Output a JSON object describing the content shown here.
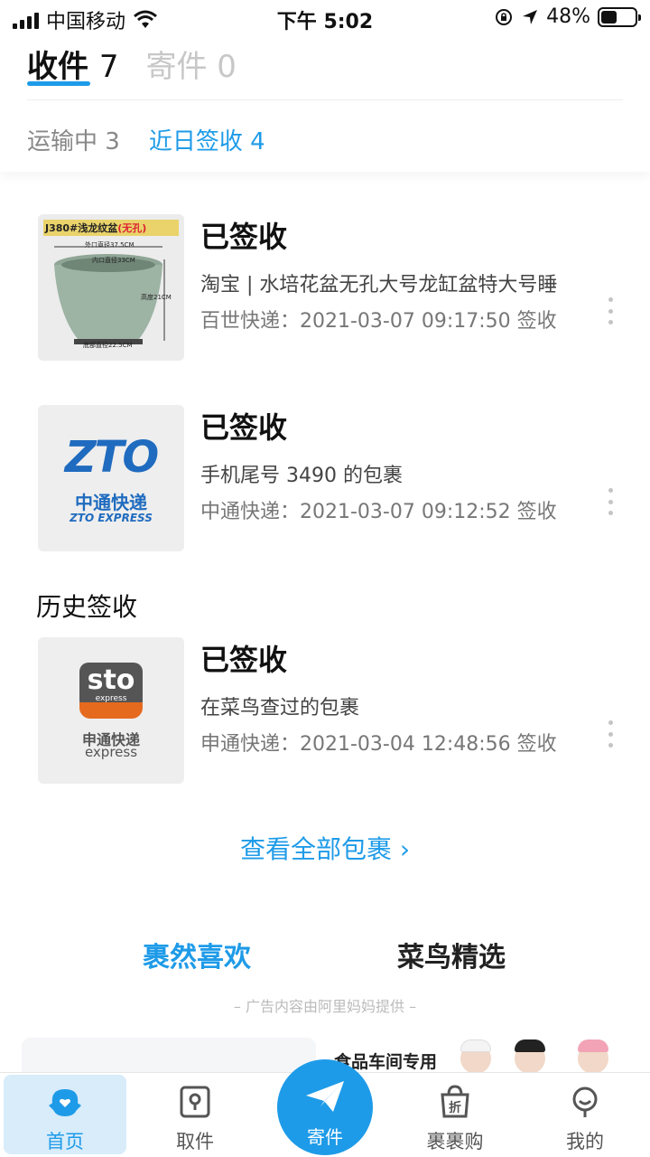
{
  "status_bar": {
    "carrier": "中国移动",
    "time": "下午 5:02",
    "battery": "48%",
    "battery_level": 0.48
  },
  "header": {
    "tabs": [
      {
        "label": "收件",
        "count": "7"
      },
      {
        "label": "寄件",
        "count": "0"
      }
    ],
    "sub_tabs": [
      {
        "label": "运输中",
        "count": "3"
      },
      {
        "label": "近日签收",
        "count": "4"
      }
    ]
  },
  "packages": [
    {
      "status": "已签收",
      "description": "淘宝 | 水培花盆无孔大号龙缸盆特大号睡",
      "meta": "百世快递：2021-03-07 09:17:50 签收",
      "thumb_text": {
        "title": "J380#浅龙纹盆",
        "title_tag": "(无孔)",
        "outer": "外口直径37.5CM",
        "inner": "内口直径33CM",
        "height": "高度21CM",
        "bottom": "底部直径22.5CM"
      }
    },
    {
      "status": "已签收",
      "description": "手机尾号 3490 的包裹",
      "meta": "中通快递：2021-03-07 09:12:52 签收",
      "logo": {
        "mark": "ZTO",
        "cn": "中通快递",
        "en": "ZTO EXPRESS"
      }
    }
  ],
  "history": {
    "title": "历史签收",
    "packages": [
      {
        "status": "已签收",
        "description": "在菜鸟查过的包裹",
        "meta": "申通快递：2021-03-04 12:48:56 签收",
        "logo": {
          "mark": "sto",
          "sub": "express",
          "cn": "申通快递",
          "en": "express"
        }
      }
    ]
  },
  "view_all": "查看全部包裹 ›",
  "recommend": {
    "tabs": [
      "裹然喜欢",
      "菜鸟精选"
    ],
    "ad_note": "– 广告内容由阿里妈妈提供 –",
    "banner_text": "食品车间专用"
  },
  "tab_bar": {
    "items": [
      "首页",
      "取件",
      "寄件",
      "裹裹购",
      "我的"
    ]
  },
  "colors": {
    "accent": "#1e9be8",
    "tab_active_bg": "#d8ecfa"
  }
}
